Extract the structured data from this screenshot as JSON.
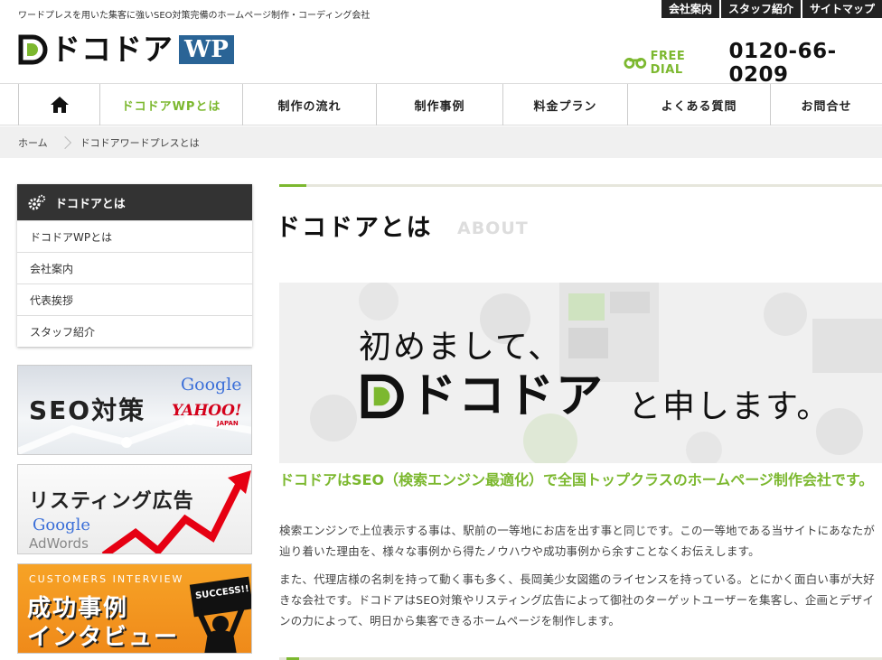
{
  "header": {
    "tagline": "ワードプレスを用いた集客に強いSEO対策完備のホームページ制作・コーディング会社",
    "topnav": [
      "会社案内",
      "スタッフ紹介",
      "サイトマップ"
    ],
    "logo_text": "ドコドア",
    "logo_wp": "WP",
    "freedial_label": "FREE DIAL",
    "phone": "0120-66-0209"
  },
  "nav": {
    "items": [
      "ドコドアWPとは",
      "制作の流れ",
      "制作事例",
      "料金プラン",
      "よくある質問",
      "お問合せ"
    ]
  },
  "breadcrumb": [
    "ホーム",
    "ドコドアワードプレスとは"
  ],
  "sidebar": {
    "heading": "ドコドアとは",
    "items": [
      "ドコドアWPとは",
      "会社案内",
      "代表挨拶",
      "スタッフ紹介"
    ],
    "banners": {
      "seo_title": "SEO対策",
      "seo_google": "Google",
      "seo_yahoo": "YAHOO!",
      "seo_japan": "JAPAN",
      "listing_title": "リスティング広告",
      "listing_google": "Google",
      "listing_adwords": "AdWords",
      "interview_caption": "CUSTOMERS INTERVIEW",
      "interview_line1": "成功事例",
      "interview_line2": "インタビュー",
      "interview_sign": "SUCCESS!!"
    }
  },
  "main": {
    "title": "ドコドアとは",
    "subtitle": "ABOUT",
    "hero_line1": "初めまして、",
    "hero_logo": "ドコドア",
    "hero_line2": "と申します。",
    "headline": "ドコドアはSEO（検索エンジン最適化）で全国トップクラスのホームページ制作会社です。",
    "para1": "検索エンジンで上位表示する事は、駅前の一等地にお店を出す事と同じです。この一等地である当サイトにあなたが辿り着いた理由を、様々な事例から得たノウハウや成功事例から余すことなくお伝えします。",
    "para2": "また、代理店様の名刺を持って動く事も多く、長岡美少女図鑑のライセンスを持っている。とにかく面白い事が大好きな会社です。ドコドアはSEO対策やリスティング広告によって御社のターゲットユーザーを集客し、企画とデザインの力によって、明日から集客できるホームページを制作します。"
  },
  "colors": {
    "accent": "#7cb82f",
    "dark": "#333333",
    "wp_blue": "#2a6496",
    "orange": "#f29222"
  }
}
